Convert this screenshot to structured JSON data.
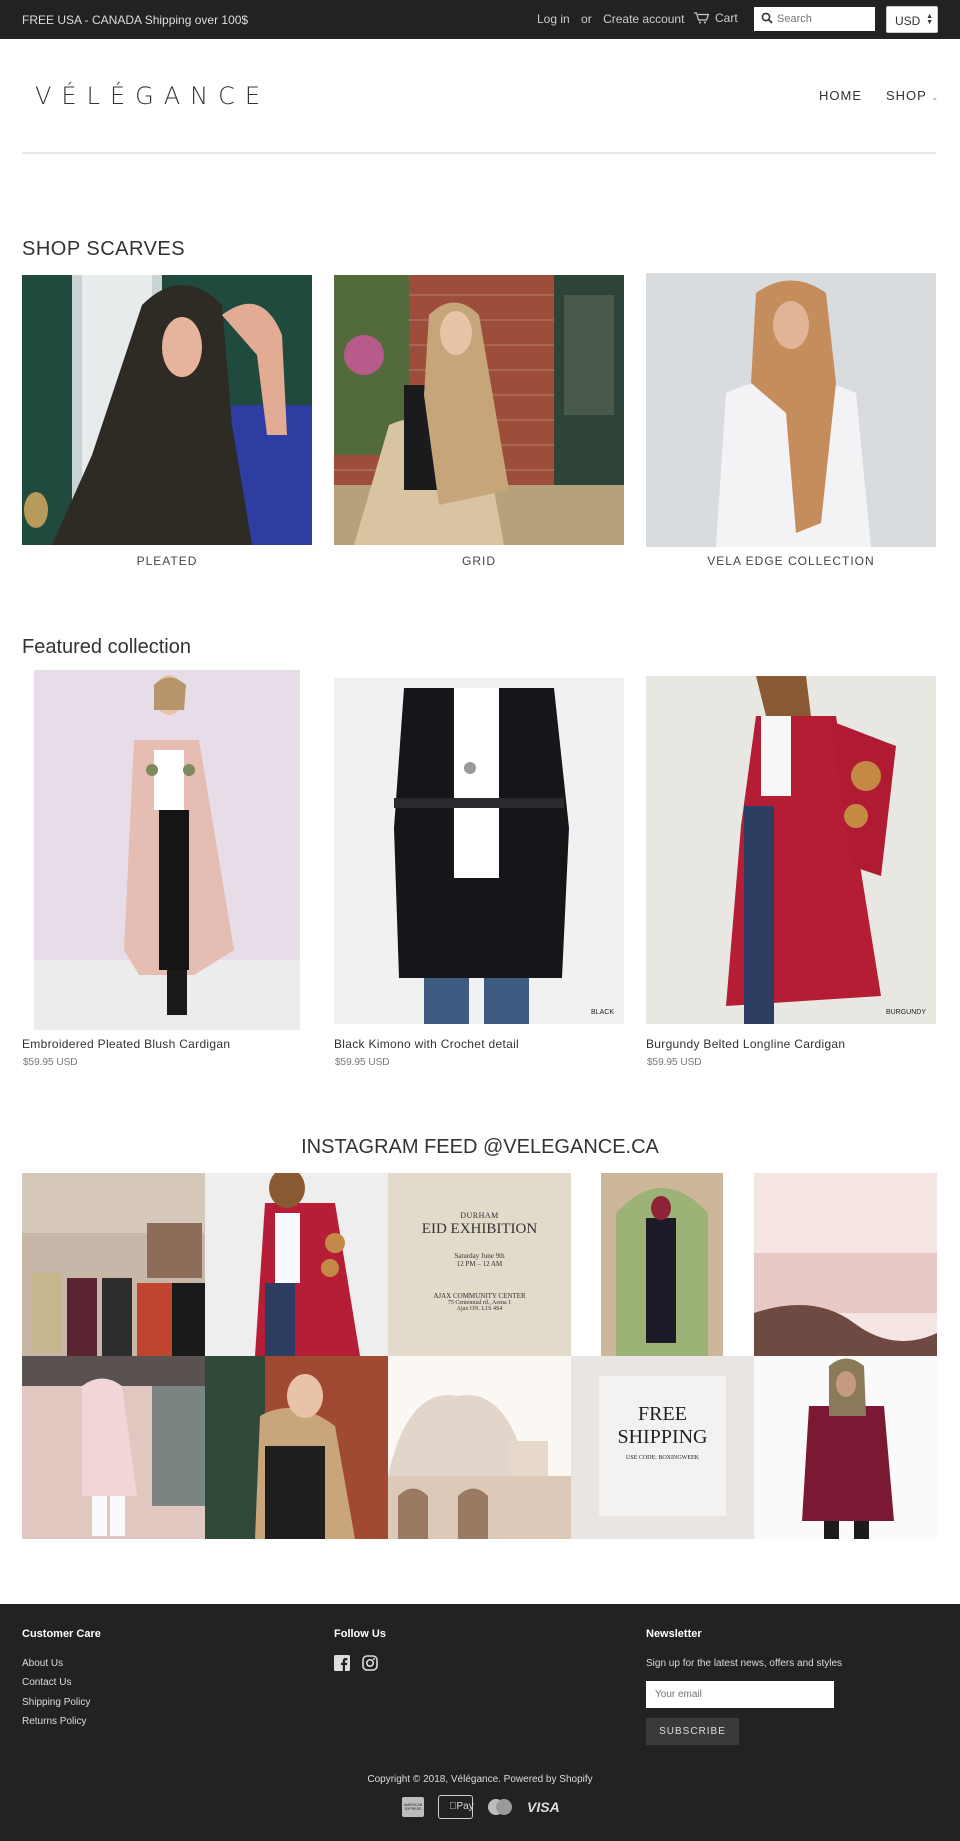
{
  "topbar": {
    "promo": "FREE USA - CANADA Shipping over 100$",
    "login": "Log in",
    "or": "or",
    "create_account": "Create account",
    "cart": "Cart",
    "search_placeholder": "Search",
    "currency": "USD"
  },
  "header": {
    "logo": "VÉLÉGANCE",
    "nav": {
      "home": "HOME",
      "shop": "SHOP"
    }
  },
  "scarves": {
    "heading": "SHOP SCARVES",
    "items": [
      {
        "label": "PLEATED"
      },
      {
        "label": "GRID"
      },
      {
        "label": "VELA EDGE COLLECTION"
      }
    ]
  },
  "featured": {
    "heading": "Featured collection",
    "products": [
      {
        "title": "Embroidered Pleated Blush Cardigan",
        "price": "$59.95 USD",
        "tag": ""
      },
      {
        "title": "Black Kimono with Crochet detail",
        "price": "$59.95 USD",
        "tag": "BLACK"
      },
      {
        "title": "Burgundy Belted Longline Cardigan",
        "price": "$59.95 USD",
        "tag": "BURGUNDY"
      }
    ]
  },
  "instagram": {
    "heading": "INSTAGRAM FEED @VELEGANCE.CA",
    "eid": {
      "line1": "DURHAM",
      "line2": "EID EXHIBITION",
      "line3": "Saturday June 9th",
      "line4": "12 PM – 12 AM",
      "line5": "AJAX COMMUNITY CENTER",
      "line6": "75 Centennial rd., Arena 1",
      "line7": "Ajax ON. L1S 4S4"
    },
    "shipping": {
      "line1": "FREE",
      "line2": "SHIPPING",
      "line3": "USE CODE: BOXINGWEEK"
    }
  },
  "footer": {
    "care_heading": "Customer Care",
    "care_links": [
      "About Us",
      "Contact Us",
      "Shipping Policy",
      "Returns Policy"
    ],
    "follow_heading": "Follow Us",
    "news_heading": "Newsletter",
    "news_text": "Sign up for the latest news, offers and styles",
    "email_placeholder": "Your email",
    "subscribe": "SUBSCRIBE",
    "copyright": "Copyright © 2018, Vélégance. Powered by Shopify",
    "payments": [
      "american-express-icon",
      "apple-pay-icon",
      "mastercard-icon",
      "visa-icon"
    ],
    "visa_text": "VISA",
    "applepay_text": "Pay",
    "amex_text": "AMERICAN EXPRESS"
  },
  "colors": {
    "topbar_bg": "#222222",
    "footer_bg": "#222222",
    "text": "#333333"
  }
}
